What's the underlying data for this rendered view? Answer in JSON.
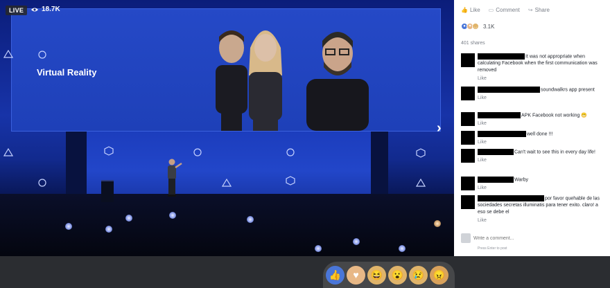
{
  "video": {
    "live_label": "LIVE",
    "viewer_count": "18.7K",
    "screen_title": "Virtual Reality"
  },
  "actions": {
    "like": "Like",
    "comment": "Comment",
    "share": "Share"
  },
  "reaction_summary": {
    "count": "3.1K",
    "icons": [
      "like-icon",
      "love-icon",
      "haha-icon"
    ]
  },
  "shares_text": "401 shares",
  "comments": [
    {
      "text": "It was not appropriate when calculating Facebook when the first communication was removed",
      "like": "Like"
    },
    {
      "text": "soundwalkrs app present",
      "like": "Like"
    },
    {
      "text": "APK Facebook not working 😬",
      "like": "Like"
    },
    {
      "text": "well done !!!",
      "like": "Like"
    },
    {
      "text": "Can't wait to see this in every day life!",
      "like": "Like"
    },
    {
      "text": "Warby",
      "like": "Like"
    },
    {
      "text": "por favor quehable de las sociedades secretas illuminatis para tener exito. claro! a eso se debe el",
      "like": "Like"
    }
  ],
  "comment_input": {
    "placeholder": "Write a comment...",
    "hint": "Press Enter to post"
  },
  "reaction_bar": [
    {
      "name": "like-reaction",
      "icon": "thumbs-up-icon",
      "glyph": "👍",
      "color": "#4a76d8"
    },
    {
      "name": "love-reaction",
      "icon": "heart-icon",
      "glyph": "♥",
      "color": "#e8b886"
    },
    {
      "name": "haha-reaction",
      "icon": "laughing-face-icon",
      "glyph": "😆",
      "color": "#e0b46a"
    },
    {
      "name": "wow-reaction",
      "icon": "surprised-face-icon",
      "glyph": "😮",
      "color": "#e0b46a"
    },
    {
      "name": "sad-reaction",
      "icon": "sad-face-icon",
      "glyph": "😢",
      "color": "#e0b46a"
    },
    {
      "name": "angry-reaction",
      "icon": "angry-face-icon",
      "glyph": "😠",
      "color": "#d9a25c"
    }
  ]
}
